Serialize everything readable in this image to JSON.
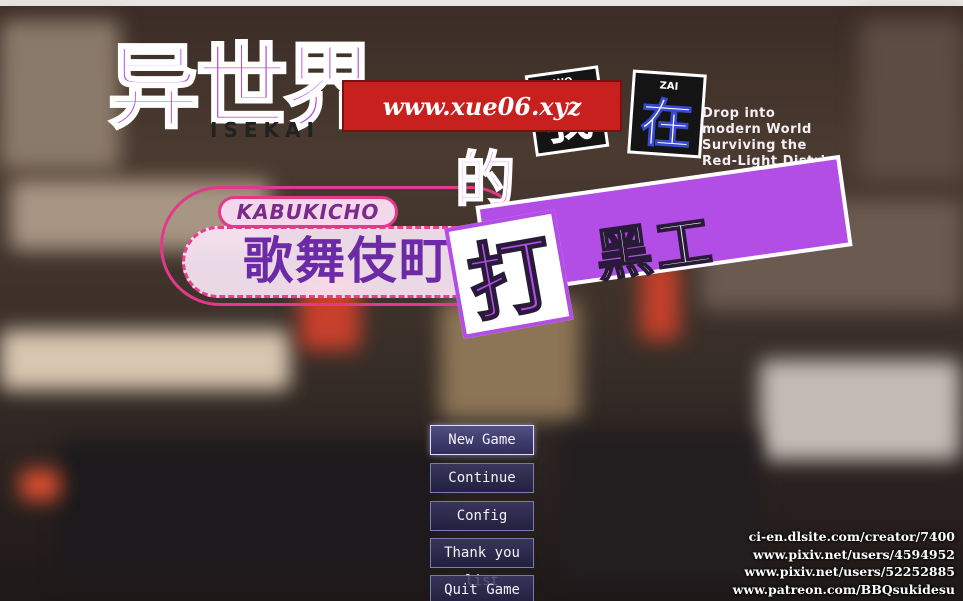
{
  "logo": {
    "title_kanji": "异世界",
    "title_romaji": "ISEKAI",
    "possessive": "的",
    "card_wo_small": "WO",
    "card_wo": "我",
    "card_zai_small": "ZAI",
    "card_zai": "在",
    "subtitle_roman": "KABUKICHO",
    "subtitle_kanji": "歌舞伎町",
    "banner_da": "打",
    "banner_text": "黑工",
    "tagline_lines": [
      "Drop into",
      "modern World",
      "Surviving the",
      "Red-Light District"
    ]
  },
  "watermark": {
    "text": "www.xue06.xyz"
  },
  "menu": {
    "items": [
      {
        "label": "New Game",
        "active": true
      },
      {
        "label": "Continue",
        "active": false
      },
      {
        "label": "Config",
        "active": false
      },
      {
        "label": "Thank you list",
        "active": false
      },
      {
        "label": "Quit Game",
        "active": false
      }
    ]
  },
  "credits": {
    "lines": [
      "ci-en.dlsite.com/creator/7400",
      "www.pixiv.net/users/4594952",
      "www.pixiv.net/users/52252885",
      "www.patreon.com/BBQsukidesu"
    ]
  },
  "colors": {
    "logo_purple": "#b24ee6",
    "logo_pink": "#e23a8a",
    "watermark_red": "#c8201e",
    "menu_bg": "#3c3a68"
  }
}
